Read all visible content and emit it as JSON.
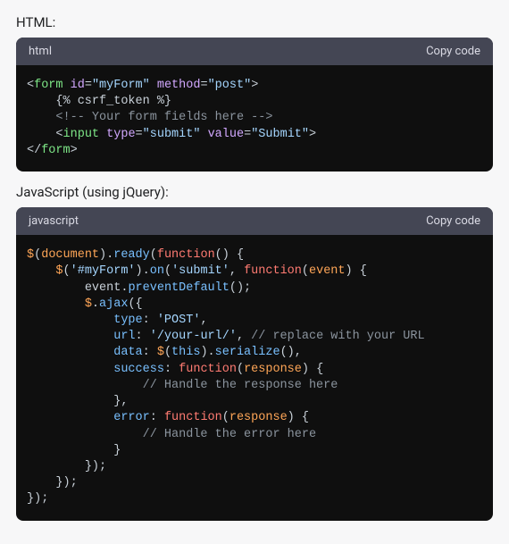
{
  "labels": {
    "html_label": "HTML:",
    "js_label": "JavaScript (using jQuery):"
  },
  "headers": {
    "html_lang": "html",
    "js_lang": "javascript",
    "copy": "Copy code"
  },
  "code_html": {
    "l1_open": "<",
    "l1_tag": "form",
    "l1_sp": " ",
    "l1_a1": "id",
    "l1_eq": "=",
    "l1_v1": "\"myForm\"",
    "l1_sp2": " ",
    "l1_a2": "method",
    "l1_v2": "\"post\"",
    "l1_close": ">",
    "l2_indent": "    ",
    "l2_txt": "{% csrf_token %}",
    "l3_indent": "    ",
    "l3_open": "<!--",
    "l3_txt": " Your form fields here ",
    "l3_close": "-->",
    "l4_indent": "    ",
    "l4_open": "<",
    "l4_tag": "input",
    "l4_sp": " ",
    "l4_a1": "type",
    "l4_v1": "\"submit\"",
    "l4_sp2": " ",
    "l4_a2": "value",
    "l4_v2": "\"Submit\"",
    "l4_close": ">",
    "l5_open": "</",
    "l5_tag": "form",
    "l5_close": ">"
  },
  "code_js": {
    "j1_dol": "$",
    "j1_p1": "(",
    "j1_doc": "document",
    "j1_p2": ").",
    "j1_ready": "ready",
    "j1_p3": "(",
    "j1_fn": "function",
    "j1_p4": "() {",
    "j2_ind": "    ",
    "j2_dol": "$",
    "j2_p1": "(",
    "j2_sel": "'#myForm'",
    "j2_p2": ").",
    "j2_on": "on",
    "j2_p3": "(",
    "j2_ev": "'submit'",
    "j2_p4": ", ",
    "j2_fn": "function",
    "j2_p5": "(",
    "j2_evt": "event",
    "j2_p6": ") {",
    "j3_ind": "        ",
    "j3_evt": "event",
    "j3_dot": ".",
    "j3_pd": "preventDefault",
    "j3_p": "();",
    "j4_ind": "        ",
    "j4_dol": "$",
    "j4_dot": ".",
    "j4_ajax": "ajax",
    "j4_p": "({",
    "j5_ind": "            ",
    "j5_k": "type",
    "j5_c": ": ",
    "j5_v": "'POST'",
    "j5_cm": ",",
    "j6_ind": "            ",
    "j6_k": "url",
    "j6_c": ": ",
    "j6_v": "'/your-url/'",
    "j6_cm": ", ",
    "j6_cmt": "// replace with your URL",
    "j7_ind": "            ",
    "j7_k": "data",
    "j7_c": ": ",
    "j7_dol": "$",
    "j7_p1": "(",
    "j7_this": "this",
    "j7_p2": ").",
    "j7_ser": "serialize",
    "j7_p3": "()",
    "j7_cm": ",",
    "j8_ind": "            ",
    "j8_k": "success",
    "j8_c": ": ",
    "j8_fn": "function",
    "j8_p1": "(",
    "j8_resp": "response",
    "j8_p2": ") {",
    "j9_ind": "                ",
    "j9_cmt": "// Handle the response here",
    "j10_ind": "            ",
    "j10_p": "},",
    "j11_ind": "            ",
    "j11_k": "error",
    "j11_c": ": ",
    "j11_fn": "function",
    "j11_p1": "(",
    "j11_resp": "response",
    "j11_p2": ") {",
    "j12_ind": "                ",
    "j12_cmt": "// Handle the error here",
    "j13_ind": "            ",
    "j13_p": "}",
    "j14_ind": "        ",
    "j14_p": "});",
    "j15_ind": "    ",
    "j15_p": "});",
    "j16_p": "});"
  }
}
